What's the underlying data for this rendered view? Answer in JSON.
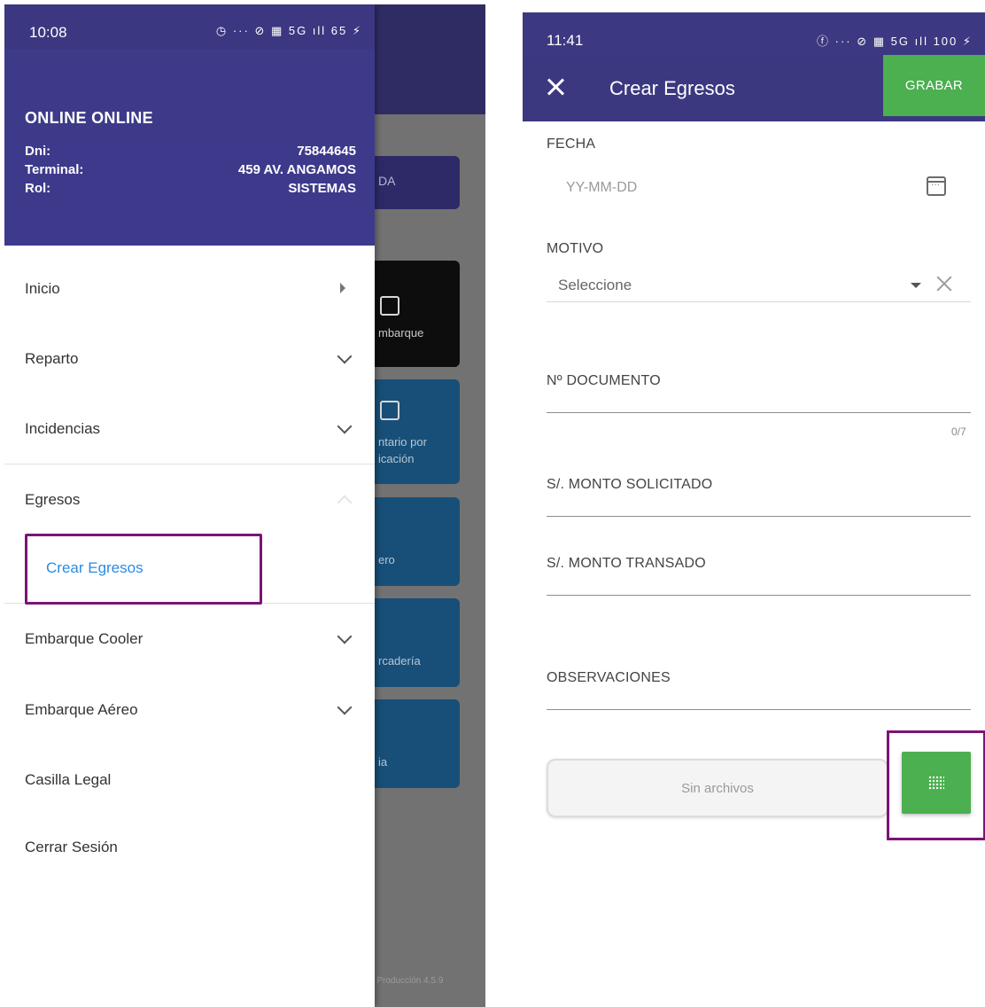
{
  "left_screen": {
    "status": {
      "time": "10:08",
      "icons": "◷ ··· ⊘ ▦ 5G ıll 65 ⚡"
    },
    "background": {
      "top_button": "DA",
      "cards": [
        {
          "label": "mbarque"
        },
        {
          "label_line1": "ntario por",
          "label_line2": "icación"
        },
        {
          "label": "ero"
        },
        {
          "label": "rcadería"
        },
        {
          "label": "ia"
        }
      ],
      "version": "n Producción 4.5.9"
    },
    "drawer": {
      "user_name": "ONLINE ONLINE",
      "dni_label": "Dni:",
      "dni_value": "75844645",
      "terminal_label": "Terminal:",
      "terminal_value": "459 AV. ANGAMOS",
      "rol_label": "Rol:",
      "rol_value": "SISTEMAS",
      "items": [
        {
          "label": "Inicio"
        },
        {
          "label": "Reparto"
        },
        {
          "label": "Incidencias"
        },
        {
          "label": "Egresos"
        },
        {
          "label": "Embarque Cooler"
        },
        {
          "label": "Embarque Aéreo"
        },
        {
          "label": "Casilla Legal"
        },
        {
          "label": "Cerrar Sesión"
        }
      ],
      "sub_item": "Crear Egresos"
    }
  },
  "right_screen": {
    "status": {
      "time": "11:41",
      "icons": "ⓕ ··· ⊘ ▦ 5G ıll 100 ⚡"
    },
    "appbar": {
      "title": "Crear Egresos",
      "save_label": "GRABAR"
    },
    "form": {
      "fecha_label": "FECHA",
      "fecha_placeholder": "YY-MM-DD",
      "motivo_label": "MOTIVO",
      "motivo_value": "Seleccione",
      "documento_label": "Nº DOCUMENTO",
      "documento_counter": "0/7",
      "monto_solicitado_label": "S/. MONTO SOLICITADO",
      "monto_transado_label": "S/. MONTO TRANSADO",
      "observaciones_label": "OBSERVACIONES",
      "attachments_text": "Sin archivos"
    }
  },
  "colors": {
    "primary": "#3c3880",
    "accent_green": "#4caf50",
    "highlight": "#7a1475",
    "link_blue": "#2b8be4"
  }
}
